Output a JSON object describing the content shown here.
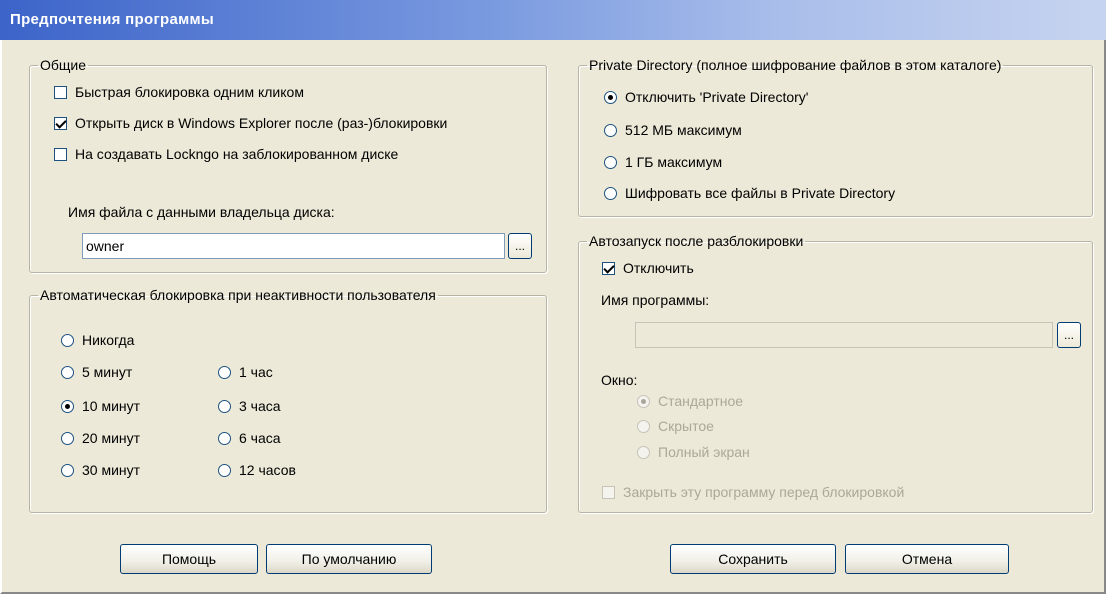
{
  "window": {
    "title": "Предпочтения программы"
  },
  "general": {
    "legend": "Общие",
    "options": [
      {
        "label": "Быстрая блокировка одним кликом",
        "checked": false
      },
      {
        "label": "Открыть диск в Windows Explorer после (раз-)блокировки",
        "checked": true
      },
      {
        "label": "На создавать Lockngo на заблокированном диске",
        "checked": false
      }
    ],
    "owner_file_label": "Имя файла с данными владельца диска:",
    "owner_file_value": "owner",
    "browse_label": "..."
  },
  "autolock": {
    "legend": "Автоматическая блокировка при неактивности пользователя",
    "options": [
      {
        "label": "Никогда",
        "selected": false
      },
      {
        "label": "5 минут",
        "selected": false
      },
      {
        "label": "10 минут",
        "selected": true
      },
      {
        "label": "20 минут",
        "selected": false
      },
      {
        "label": "30 минут",
        "selected": false
      },
      {
        "label": "1 час",
        "selected": false
      },
      {
        "label": "3 часа",
        "selected": false
      },
      {
        "label": "6 часа",
        "selected": false
      },
      {
        "label": "12 часов",
        "selected": false
      }
    ]
  },
  "private_dir": {
    "legend": "Private Directory (полное шифрование файлов в этом каталоге)",
    "options": [
      {
        "label": "Отключить 'Private Directory'",
        "selected": true
      },
      {
        "label": "512 МБ максимум",
        "selected": false
      },
      {
        "label": "1 ГБ максимум",
        "selected": false
      },
      {
        "label": "Шифровать все файлы в Private Directory",
        "selected": false
      }
    ]
  },
  "autorun": {
    "legend": "Автозапуск после разблокировки",
    "disable_label": "Отключить",
    "disable_checked": true,
    "program_label": "Имя программы:",
    "program_value": "",
    "browse_label": "...",
    "window_label": "Окно:",
    "window_options": [
      {
        "label": "Стандартное",
        "selected": true
      },
      {
        "label": "Скрытое",
        "selected": false
      },
      {
        "label": "Полный экран",
        "selected": false
      }
    ],
    "close_label": "Закрыть эту программу перед блокировкой",
    "close_checked": false
  },
  "buttons": {
    "help": "Помощь",
    "defaults": "По умолчанию",
    "save": "Сохранить",
    "cancel": "Отмена"
  }
}
